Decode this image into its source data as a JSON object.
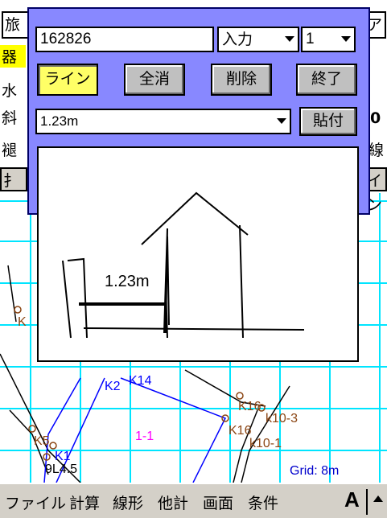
{
  "dialog": {
    "number_field": "162826",
    "mode_select": "入力",
    "count_select": "1",
    "buttons": {
      "line": "ライン",
      "clear_all": "全消",
      "delete": "削除",
      "finish": "終了",
      "paste": "貼付"
    },
    "distance_select": "1.23m",
    "sketch_label": "1.23m"
  },
  "background": {
    "labels": {
      "k2": "K2",
      "k14": "K14",
      "k16a": "K16",
      "k16b": "K16",
      "k10_3": "k10-3",
      "k10_1": "k10-1",
      "k5": "K5",
      "k1": "K1",
      "point45": "9L4.5",
      "area": "1-1",
      "k_left": "K"
    },
    "grid_text": "Grid: 8m",
    "row_chars": [
      "旅",
      "器",
      "水",
      "斜",
      "褪",
      "扌"
    ],
    "right_chars": [
      "ア",
      "0",
      "線",
      "イン"
    ]
  },
  "menubar": {
    "items": [
      "ファイル",
      "計算",
      "線形",
      "他計",
      "画面",
      "条件"
    ],
    "input_mode": "A"
  },
  "colors": {
    "dialog_bg": "#8888ff",
    "grid": "#00ffff",
    "active_button": "#ffff66",
    "blue_line": "#0000ff",
    "point_label": "#8b4513",
    "area_label": "#ff00ff"
  }
}
